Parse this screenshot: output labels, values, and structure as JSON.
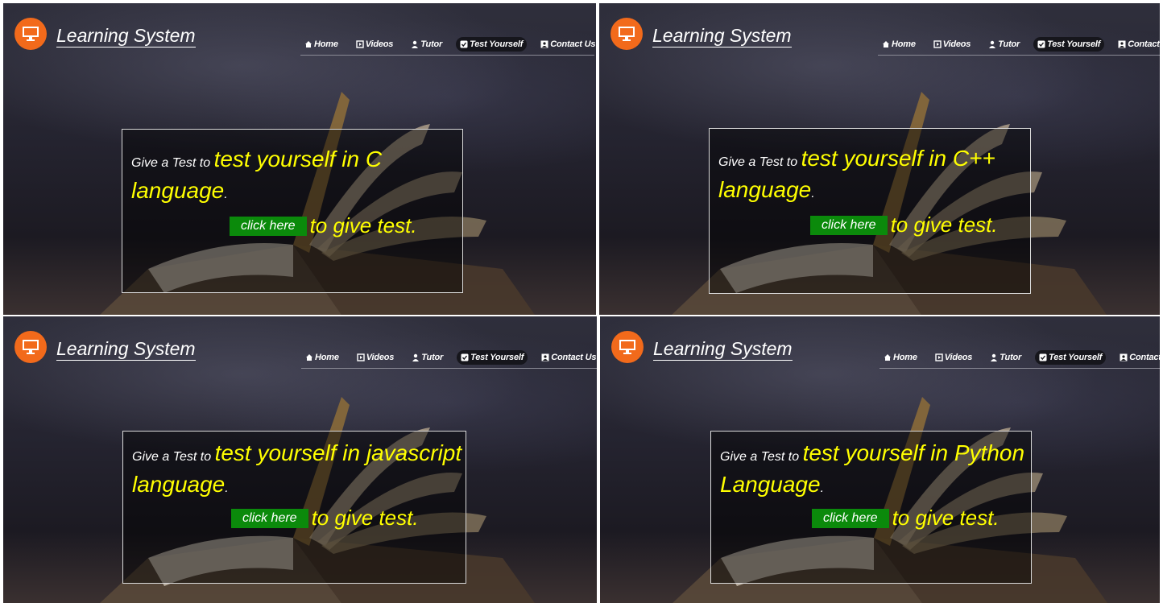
{
  "brand": {
    "title": "Learning System",
    "logo_icon": "monitor-icon",
    "logo_color": "#f26a1b"
  },
  "nav": [
    {
      "label": "Home",
      "icon": "home-icon"
    },
    {
      "label": "Videos",
      "icon": "video-icon"
    },
    {
      "label": "Tutor",
      "icon": "user-icon"
    },
    {
      "label": "Test Yourself",
      "icon": "checkbox-icon",
      "active": true
    },
    {
      "label": "Contact Us",
      "icon": "contact-icon"
    }
  ],
  "panels": [
    {
      "lead": "Give a Test to ",
      "headline": "test yourself in C",
      "line2": "language",
      "period": ".",
      "button": "click here",
      "tail": "to give test."
    },
    {
      "lead": "Give a Test to ",
      "headline": "test yourself in C++",
      "line2": "language",
      "period": ".",
      "button": "click here",
      "tail": "to give test."
    },
    {
      "lead": "Give a Test to ",
      "headline": "test yourself in javascript",
      "line2": "language",
      "period": ".",
      "button": "click here",
      "tail": "to give test."
    },
    {
      "lead": "Give a Test to ",
      "headline": "test yourself in Python",
      "line2": "Language",
      "period": ".",
      "button": "click here",
      "tail": "to give test."
    }
  ],
  "colors": {
    "accent": "#ffff00",
    "button": "#0b8a0b",
    "nav_active": "#16161c"
  }
}
